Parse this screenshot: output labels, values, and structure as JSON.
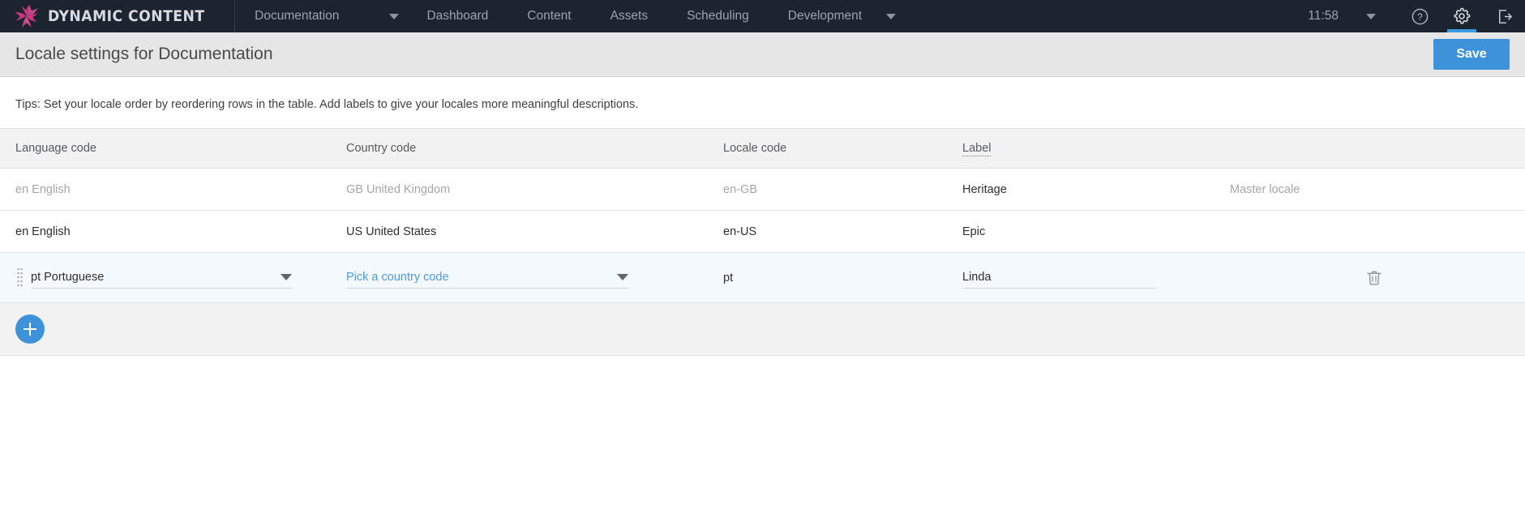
{
  "brand": {
    "name": "DYNAMIC CONTENT",
    "logo_icon": "starburst-logo-icon"
  },
  "topnav": {
    "hub_selector": {
      "label": "Documentation",
      "caret_icon": "chevron-down-icon"
    },
    "items": [
      {
        "label": "Dashboard"
      },
      {
        "label": "Content"
      },
      {
        "label": "Assets"
      },
      {
        "label": "Scheduling"
      }
    ],
    "environment_selector": {
      "label": "Development",
      "caret_icon": "chevron-down-icon"
    },
    "time": "11:58",
    "time_caret_icon": "chevron-down-icon",
    "help_icon": "question-circle-icon",
    "settings_icon": "gear-icon",
    "logout_icon": "logout-icon",
    "active_accent": "#3d9ae0"
  },
  "header": {
    "title": "Locale settings for Documentation",
    "save_label": "Save",
    "save_color": "#3d92da"
  },
  "tips": "Tips: Set your locale order by reordering rows in the table. Add labels to give your locales more meaningful descriptions.",
  "table": {
    "columns": {
      "language": "Language code",
      "country": "Country code",
      "locale": "Locale code",
      "label": "Label"
    },
    "rows": [
      {
        "language": "en English",
        "country": "GB United Kingdom",
        "locale": "en-GB",
        "label": "Heritage",
        "note": "Master locale",
        "state": "readonly-master"
      },
      {
        "language": "en English",
        "country": "US United States",
        "locale": "en-US",
        "label": "Epic",
        "note": "",
        "state": "readonly"
      },
      {
        "language": "pt Portuguese",
        "country_placeholder": "Pick a country code",
        "locale": "pt",
        "label": "Linda",
        "state": "editing",
        "drag_handle_icon": "drag-handle-icon",
        "delete_icon": "trash-icon"
      }
    ]
  },
  "add_row": {
    "icon": "plus-icon",
    "accent": "#3d92da"
  }
}
